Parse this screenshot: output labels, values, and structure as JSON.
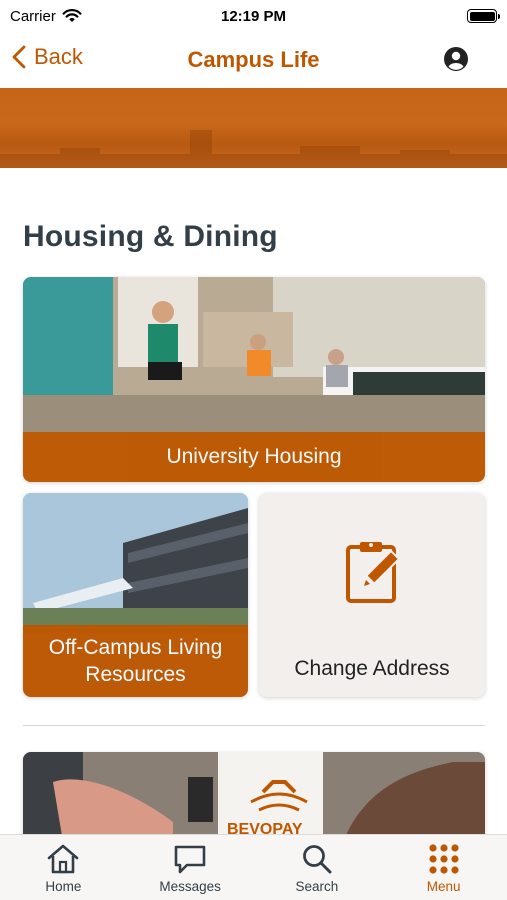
{
  "status_bar": {
    "carrier": "Carrier",
    "time": "12:19 PM"
  },
  "nav": {
    "back_label": "Back",
    "title": "Campus Life"
  },
  "section": {
    "title": "Housing & Dining"
  },
  "cards": {
    "university_housing": "University Housing",
    "off_campus_line1": "Off-Campus Living",
    "off_campus_line2": "Resources",
    "change_address": "Change Address",
    "bevo_text": "BEVOPAY"
  },
  "tab_bar": {
    "items": [
      {
        "label": "Home",
        "icon": "home-icon"
      },
      {
        "label": "Messages",
        "icon": "chat-icon"
      },
      {
        "label": "Search",
        "icon": "search-icon"
      },
      {
        "label": "Menu",
        "icon": "grid-menu-icon"
      }
    ],
    "active_index": 3
  },
  "colors": {
    "accent": "#bf5700",
    "text_dark": "#333f48",
    "tab_bar_bg": "#f7f6f4",
    "card_neutral": "#f2efec"
  }
}
